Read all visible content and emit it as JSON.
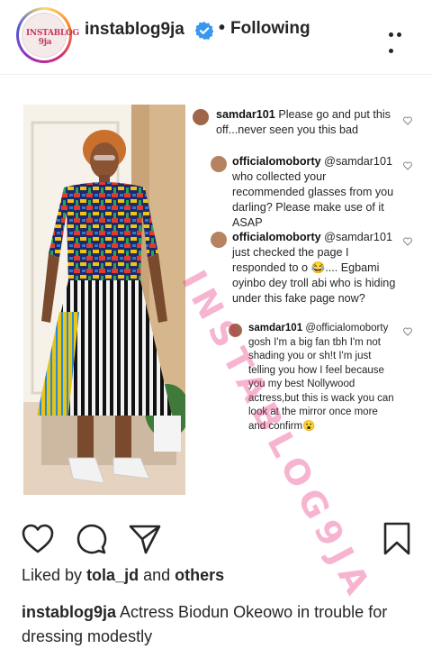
{
  "header": {
    "username": "instablog9ja",
    "avatar_text": "INSTABLOG 9ja",
    "separator": "•",
    "follow_status": "Following"
  },
  "post": {
    "watermark": "INSTABLOG9JA",
    "comments": [
      {
        "user": "samdar101",
        "text": "Please go and put this off...never seen you this bad"
      },
      {
        "user": "officialomoborty",
        "text": "@samdar101 who collected your recommended glasses from you darling? Please make use of it ASAP"
      },
      {
        "user": "officialomoborty",
        "text": "@samdar101 just checked the page I responded to o 😂.... Egbami oyinbo dey troll abi who is hiding under this fake page now?"
      },
      {
        "user": "samdar101",
        "text": "@officialomoborty gosh I'm a big fan tbh I'm not shading you or sh!t I'm just telling you how I feel because you my best Nollywood actress,but this is wack you can look at the mirror once more and confirm😮"
      }
    ]
  },
  "actions": {
    "like_icon": "heart-icon",
    "comment_icon": "comment-icon",
    "share_icon": "paper-plane-icon",
    "save_icon": "bookmark-icon"
  },
  "likes": {
    "prefix": "Liked by",
    "user": "tola_jd",
    "conj": "and",
    "others": "others"
  },
  "caption": {
    "user": "instablog9ja",
    "text": "Actress Biodun Okeowo in trouble for dressing modestly"
  },
  "colors": {
    "verified": "#3897f0",
    "text": "#262626",
    "watermark": "#e6287a"
  }
}
